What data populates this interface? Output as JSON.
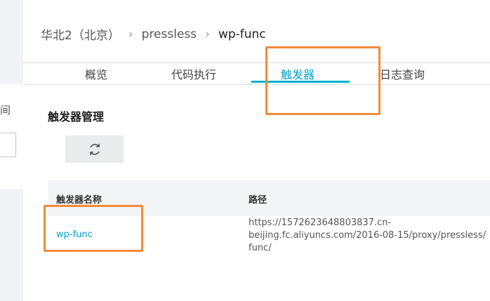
{
  "breadcrumb": {
    "region": "华北2（北京）",
    "service": "pressless",
    "function": "wp-func"
  },
  "tabs": [
    {
      "label": "概览"
    },
    {
      "label": "代码执行"
    },
    {
      "label": "触发器"
    },
    {
      "label": "日志查询"
    }
  ],
  "active_tab": "触发器",
  "left_panel": {
    "text": "间"
  },
  "section": {
    "title": "触发器管理",
    "refresh_icon": "refresh-icon"
  },
  "table": {
    "columns": [
      "触发器名称",
      "路径"
    ],
    "rows": [
      {
        "name": "wp-func",
        "path": "https://1572623648803837.cn-\nbeijing.fc.aliyuncs.com/2016-08-15/proxy/pressless/\nfunc/"
      }
    ]
  },
  "colors": {
    "accent": "#00a2ca",
    "highlight": "#f5893a"
  }
}
